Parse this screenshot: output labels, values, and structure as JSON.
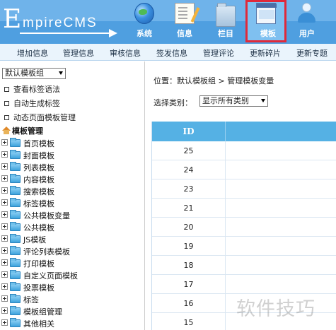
{
  "logo": {
    "big_letter": "E",
    "rest": "mpireCMS"
  },
  "top_nav": [
    {
      "label": "系统",
      "icon": "globe-icon"
    },
    {
      "label": "信息",
      "icon": "document-icon"
    },
    {
      "label": "栏目",
      "icon": "folder-icon"
    },
    {
      "label": "模板",
      "icon": "template-window-icon",
      "active": true
    },
    {
      "label": "用户",
      "icon": "user-icon"
    }
  ],
  "sub_menu": [
    "增加信息",
    "管理信息",
    "审核信息",
    "签发信息",
    "管理评论",
    "更新碎片",
    "更新专题"
  ],
  "sidebar": {
    "group_select": "默认模板组",
    "links": [
      "查看标签语法",
      "自动生成标签",
      "动态页面模板管理"
    ],
    "tree_root": "模板管理",
    "tree_items": [
      "首页模板",
      "封面模板",
      "列表模板",
      "内容模板",
      "搜索模板",
      "标签模板",
      "公共模板变量",
      "公共模板",
      "JS模板",
      "评论列表模板",
      "打印模板",
      "自定义页面模板",
      "投票模板",
      "标签",
      "模板组管理",
      "其他相关"
    ]
  },
  "main": {
    "breadcrumb": "位置：默认模板组 > 管理模板变量",
    "filter_label": "选择类别：",
    "filter_value": "显示所有类别",
    "table": {
      "header": "ID",
      "ids": [
        "25",
        "24",
        "23",
        "21",
        "20",
        "19",
        "18",
        "17",
        "16",
        "15"
      ]
    }
  },
  "watermark": "软件技巧",
  "colors": {
    "header": "#4f9fe0",
    "active_highlight": "#e0293a",
    "table_header": "#55b1e4",
    "submenu": "#eaf4fc"
  }
}
